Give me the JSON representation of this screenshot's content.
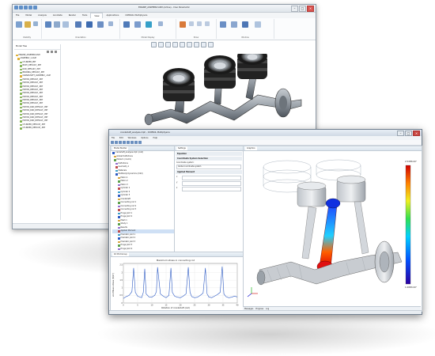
{
  "creo": {
    "window_title": "ENGINE_ASSEMBLY.ASM (Active) - Creo Parametric",
    "menu_tabs": [
      "File",
      "Model",
      "Analysis",
      "Annotate",
      "Render",
      "Tools",
      "View",
      "Applications",
      "COMSOL Multiphysics"
    ],
    "active_tab": "View",
    "ribbon_groups": [
      "Visibility",
      "Orientation",
      "Model Display",
      "Show",
      "Window"
    ],
    "model_tree_title": "Model Tree",
    "tree_items": [
      "ENGINE_ASSEMBLY.ASM",
      "ASSEMBLY_1.ASM",
      "CYLINDER_PRT",
      "BODY_DEFAULT_.PRT",
      "ROD_DEFAULT_.PRT",
      "BEARING_DEFAULT_.PRT",
      "CRANKSHAFT_ASSEMBLY_.ASM",
      "PISTON_DEFAULT_.PRT",
      "PISTON_DEFAULT_.PRT",
      "PISTON_DEFAULT_.PRT",
      "PISTON_DEFAULT_.PRT",
      "PISTON_DEFAULT_.PRT",
      "PISTON_DEFAULT_.PRT",
      "PISTON_DEFAULT_.PRT",
      "PISTON_DEFAULT_.PRT",
      "PISTON_ROD_DEFAULT_.PRT",
      "PISTON_ROD_DEFAULT_.PRT",
      "PISTON_ROD_DEFAULT_.PRT",
      "PISTON_ROD_DEFAULT_.PRT",
      "PISTON_ROD_DEFAULT_.PRT",
      "CYLINDER_DEFAULT_.PRT",
      "CYLINDER_DEFAULT_.PRT"
    ]
  },
  "comsol": {
    "window_title": "crankshaft_analysis.mph - COMSOL Multiphysics",
    "menu": [
      "File",
      "Edit",
      "Windows",
      "Options",
      "Help"
    ],
    "model_builder_title": "Model Builder",
    "settings_title": "Settings",
    "graphics_title": "Graphics",
    "tree_items": [
      "crankshaft_analysis.mph (root)",
      "Global Definitions",
      "Model 1 (mod1)",
      "Definitions",
      "Geometry 1",
      "Materials",
      "Multibody Dynamics (mbd)",
      "Piston 1",
      "Piston 2",
      "Piston 3",
      "Cylinder 1",
      "Cylinder 2",
      "Cylinder 3",
      "Crankshaft",
      "Connecting rod 1",
      "Connecting rod 2",
      "Connecting rod 3",
      "Hinge Joint 1",
      "Hinge Joint 2",
      "Mesh 1",
      "Study 1",
      "Results",
      "Applied Moment",
      "Prismatic Joint 1",
      "Prismatic Joint 2",
      "Prismatic Joint 3",
      "Hinge Joint 3",
      "Hinge Joint 4"
    ],
    "settings_sections": [
      "Equation",
      "Coordinate System Selection",
      "Applied Moment"
    ],
    "settings_field_label": "Coordinate system:",
    "settings_field_value": "Global coordinate system",
    "plot_title": "Maximum stress in connecting rod",
    "plot_xlabel": "Rotation of crankshaft (rad)",
    "plot_ylabel": "von Mises stress (N/m²)",
    "colorbar_max": "2.5438x10⁸",
    "colorbar_min": "1.0083x10³",
    "bottom_tabs": [
      "Messages",
      "Progress",
      "Log"
    ]
  },
  "colors": {
    "accent_blue": "#2b59c3",
    "stress_red": "#d8211b",
    "creo_title_bg": "#e7ecf1",
    "comsol_title_bg": "#dde6f0"
  },
  "chart_data": {
    "type": "line",
    "title": "Maximum stress in connecting rod",
    "xlabel": "Rotation of crankshaft (rad)",
    "ylabel": "von Mises stress (N/m²)",
    "xlim": [
      0,
      40
    ],
    "ylim": [
      0,
      2.6
    ],
    "x_ticks": [
      0,
      5,
      10,
      15,
      20,
      25,
      30,
      35,
      40
    ],
    "y_ticks": [
      0,
      0.5,
      1,
      1.5,
      2,
      2.5
    ],
    "series": [
      {
        "x": [
          0,
          1,
          2,
          3,
          3.6,
          4.2,
          5,
          6.4,
          7,
          7.5,
          8,
          9,
          10,
          10.5,
          11,
          11.6,
          12,
          13,
          14,
          15,
          16,
          16.7,
          17.2,
          18,
          19,
          20,
          21,
          22,
          22.8,
          23.4,
          24,
          25,
          26,
          27,
          28,
          28.8,
          29.4,
          30,
          31,
          32,
          33,
          34,
          34.7,
          35.3,
          36,
          37,
          38,
          39,
          40
        ],
        "y": [
          0.3,
          0.42,
          0.5,
          0.75,
          2.3,
          0.7,
          0.45,
          0.35,
          0.7,
          2.25,
          0.6,
          0.4,
          0.38,
          0.45,
          0.5,
          0.75,
          2.35,
          0.6,
          0.45,
          0.35,
          0.5,
          2.3,
          0.7,
          0.45,
          0.38,
          0.35,
          0.45,
          0.6,
          2.35,
          0.7,
          0.42,
          0.35,
          0.38,
          0.5,
          0.65,
          2.3,
          0.6,
          0.4,
          0.35,
          0.45,
          0.55,
          0.7,
          2.4,
          0.6,
          0.42,
          0.35,
          0.38,
          0.45,
          0.4
        ]
      }
    ]
  }
}
